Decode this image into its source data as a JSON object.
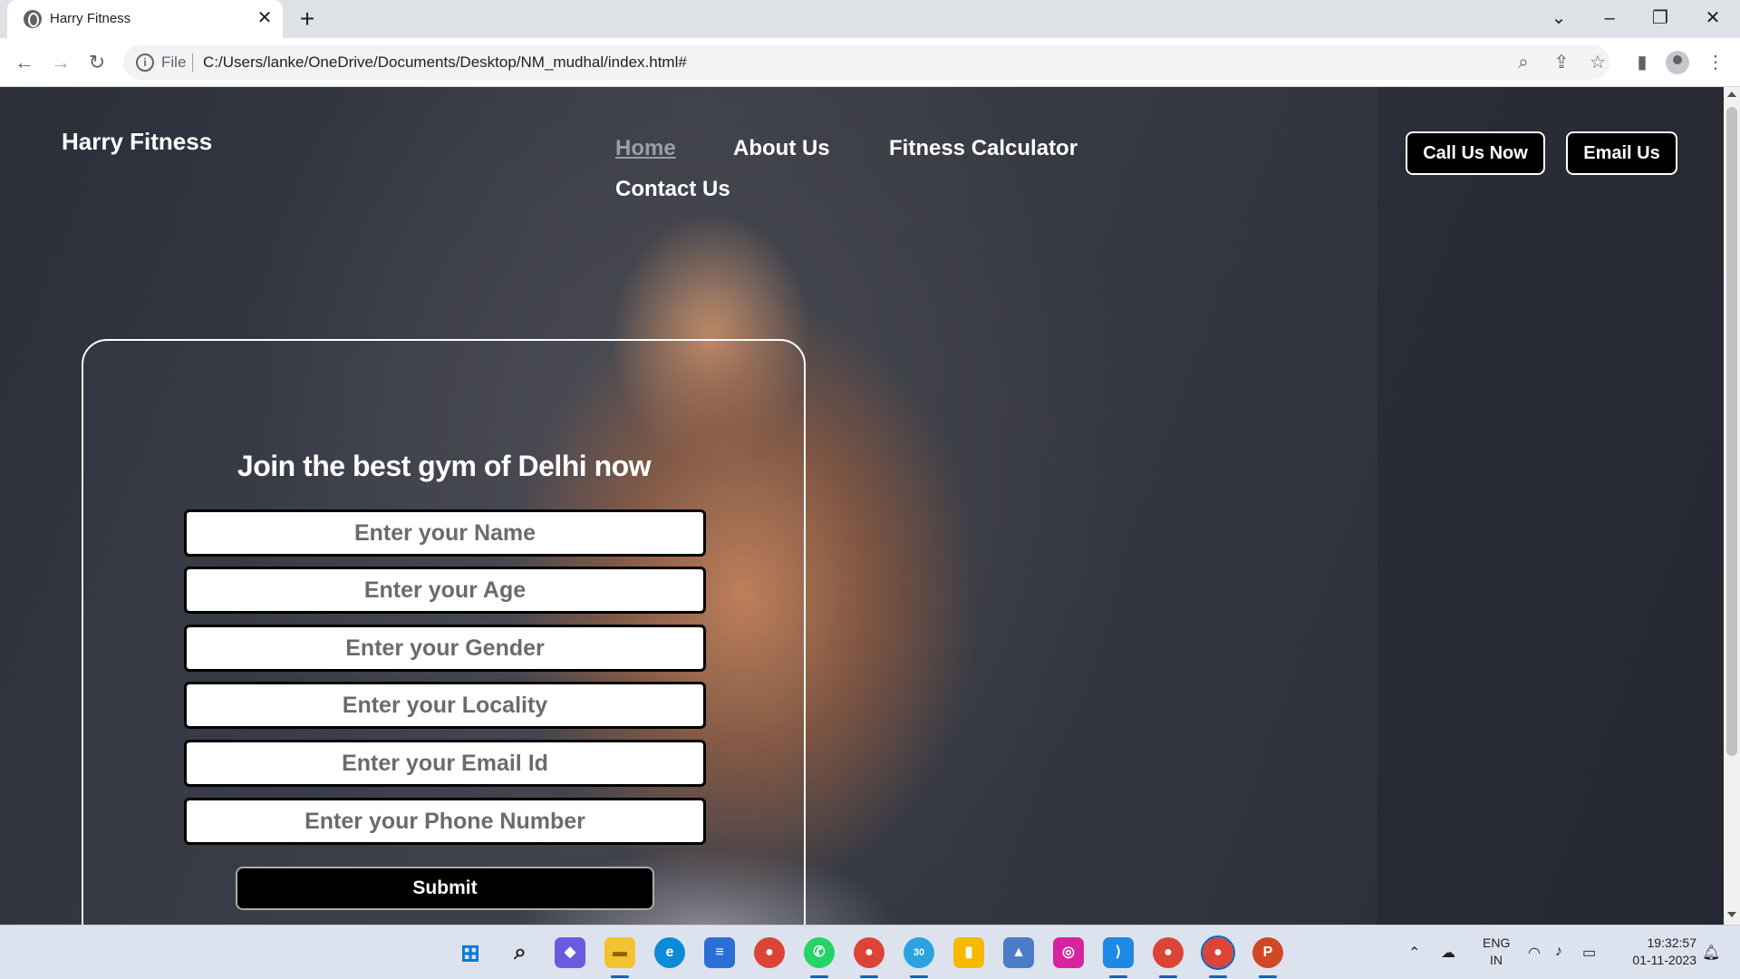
{
  "browser": {
    "tab_title": "Harry Fitness",
    "tab_close": "✕",
    "new_tab": "+",
    "address_scheme": "File",
    "address_url": "C:/Users/lanke/OneDrive/Documents/Desktop/NM_mudhal/index.html#"
  },
  "page": {
    "brand": "Harry Fitness",
    "nav": {
      "home": "Home",
      "about": "About Us",
      "calculator": "Fitness Calculator",
      "contact": "Contact Us"
    },
    "call_button": "Call Us Now",
    "email_button": "Email Us",
    "form": {
      "title": "Join the best gym of Delhi now",
      "name_placeholder": "Enter your Name",
      "age_placeholder": "Enter your Age",
      "gender_placeholder": "Enter your Gender",
      "locality_placeholder": "Enter your Locality",
      "email_placeholder": "Enter your Email Id",
      "phone_placeholder": "Enter your Phone Number",
      "submit_label": "Submit"
    }
  },
  "taskbar": {
    "language_line1": "ENG",
    "language_line2": "IN",
    "time": "19:32:57",
    "date": "01-11-2023",
    "telegram_badge": "30",
    "colors": {
      "accent": "#0067c0"
    }
  }
}
